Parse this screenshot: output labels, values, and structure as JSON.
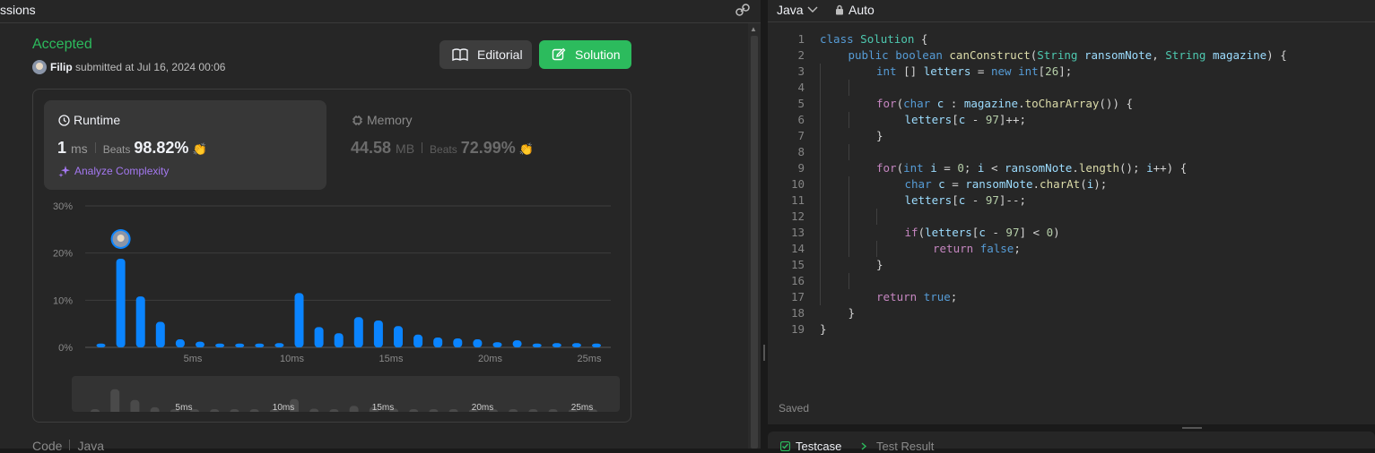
{
  "left_panel": {
    "header_title": "ssions",
    "status": "Accepted",
    "submitter": "Filip",
    "submitted_text": "submitted at Jul 16, 2024 00:06",
    "editorial_label": "Editorial",
    "solution_label": "Solution",
    "runtime": {
      "label": "Runtime",
      "value": "1",
      "unit": "ms",
      "beats_label": "Beats",
      "beats_pct": "98.82%",
      "analyze_label": "Analyze Complexity"
    },
    "memory": {
      "label": "Memory",
      "value": "44.58",
      "unit": "MB",
      "beats_label": "Beats",
      "beats_pct": "72.99%"
    },
    "code_tab": "Code",
    "code_lang": "Java"
  },
  "chart_data": {
    "type": "bar",
    "y_tick_labels": [
      "0%",
      "10%",
      "20%",
      "30%"
    ],
    "x_tick_labels": [
      "5ms",
      "10ms",
      "15ms",
      "20ms",
      "25ms"
    ],
    "ylim": [
      0,
      30
    ],
    "x": [
      0,
      1,
      2,
      3,
      4,
      5,
      6,
      7,
      8,
      9,
      10,
      11,
      12,
      13,
      14,
      15,
      16,
      17,
      18,
      19,
      20,
      21,
      22,
      23,
      24,
      25,
      26
    ],
    "values": [
      0.8,
      18.8,
      10.8,
      5.4,
      1.7,
      1.2,
      0.8,
      0.8,
      0.8,
      0.9,
      11.5,
      4.3,
      3.0,
      6.4,
      5.7,
      4.5,
      2.7,
      2.1,
      1.9,
      1.7,
      1.1,
      1.5,
      0.8,
      0.9,
      0.9,
      0.8,
      0
    ],
    "highlight_index": 1,
    "bar_color": "#0a84ff",
    "mini_color": "#4a4a4a",
    "grid": true
  },
  "editor": {
    "language": "Java",
    "mode": "Auto",
    "saved": "Saved",
    "lines": [
      {
        "n": "1",
        "indent": 0
      },
      {
        "n": "2",
        "indent": 1
      },
      {
        "n": "3",
        "indent": 2
      },
      {
        "n": "4",
        "indent": 2
      },
      {
        "n": "5",
        "indent": 2
      },
      {
        "n": "6",
        "indent": 3
      },
      {
        "n": "7",
        "indent": 2
      },
      {
        "n": "8",
        "indent": 2
      },
      {
        "n": "9",
        "indent": 2
      },
      {
        "n": "10",
        "indent": 3
      },
      {
        "n": "11",
        "indent": 3
      },
      {
        "n": "12",
        "indent": 3
      },
      {
        "n": "13",
        "indent": 3
      },
      {
        "n": "14",
        "indent": 4
      },
      {
        "n": "15",
        "indent": 2
      },
      {
        "n": "16",
        "indent": 2
      },
      {
        "n": "17",
        "indent": 2
      },
      {
        "n": "18",
        "indent": 1
      },
      {
        "n": "19",
        "indent": 0
      }
    ],
    "tokens": [
      [
        [
          "kw",
          "class"
        ],
        [
          "",
          " "
        ],
        [
          "ty",
          "Solution"
        ],
        [
          "",
          " {"
        ]
      ],
      [
        [
          "kw",
          "public"
        ],
        [
          "",
          " "
        ],
        [
          "kw",
          "boolean"
        ],
        [
          "",
          " "
        ],
        [
          "fn",
          "canConstruct"
        ],
        [
          "",
          "("
        ],
        [
          "ty",
          "String"
        ],
        [
          "",
          " "
        ],
        [
          "vr",
          "ransomNote"
        ],
        [
          "",
          ", "
        ],
        [
          "ty",
          "String"
        ],
        [
          "",
          " "
        ],
        [
          "vr",
          "magazine"
        ],
        [
          "",
          ") {"
        ]
      ],
      [
        [
          "kw",
          "int"
        ],
        [
          "",
          " [] "
        ],
        [
          "vr",
          "letters"
        ],
        [
          "",
          " = "
        ],
        [
          "kw",
          "new"
        ],
        [
          "",
          " "
        ],
        [
          "kw",
          "int"
        ],
        [
          "",
          "["
        ],
        [
          "nm",
          "26"
        ],
        [
          "",
          "];"
        ]
      ],
      [],
      [
        [
          "ctl",
          "for"
        ],
        [
          "",
          "("
        ],
        [
          "kw",
          "char"
        ],
        [
          "",
          " "
        ],
        [
          "vr",
          "c"
        ],
        [
          "",
          " : "
        ],
        [
          "vr",
          "magazine"
        ],
        [
          "",
          "."
        ],
        [
          "fn",
          "toCharArray"
        ],
        [
          "",
          "()) {"
        ]
      ],
      [
        [
          "vr",
          "letters"
        ],
        [
          "",
          "["
        ],
        [
          "vr",
          "c"
        ],
        [
          "",
          " - "
        ],
        [
          "nm",
          "97"
        ],
        [
          "",
          "]++;"
        ]
      ],
      [
        [
          "",
          "}"
        ]
      ],
      [],
      [
        [
          "ctl",
          "for"
        ],
        [
          "",
          "("
        ],
        [
          "kw",
          "int"
        ],
        [
          "",
          " "
        ],
        [
          "vr",
          "i"
        ],
        [
          "",
          " = "
        ],
        [
          "nm",
          "0"
        ],
        [
          "",
          "; "
        ],
        [
          "vr",
          "i"
        ],
        [
          "",
          " < "
        ],
        [
          "vr",
          "ransomNote"
        ],
        [
          "",
          "."
        ],
        [
          "fn",
          "length"
        ],
        [
          "",
          "(); "
        ],
        [
          "vr",
          "i"
        ],
        [
          "",
          "++) {"
        ]
      ],
      [
        [
          "kw",
          "char"
        ],
        [
          "",
          " "
        ],
        [
          "vr",
          "c"
        ],
        [
          "",
          " = "
        ],
        [
          "vr",
          "ransomNote"
        ],
        [
          "",
          "."
        ],
        [
          "fn",
          "charAt"
        ],
        [
          "",
          "("
        ],
        [
          "vr",
          "i"
        ],
        [
          "",
          ");"
        ]
      ],
      [
        [
          "vr",
          "letters"
        ],
        [
          "",
          "["
        ],
        [
          "vr",
          "c"
        ],
        [
          "",
          " - "
        ],
        [
          "nm",
          "97"
        ],
        [
          "",
          "]--;"
        ]
      ],
      [],
      [
        [
          "ctl",
          "if"
        ],
        [
          "",
          "("
        ],
        [
          "vr",
          "letters"
        ],
        [
          "",
          "["
        ],
        [
          "vr",
          "c"
        ],
        [
          "",
          " - "
        ],
        [
          "nm",
          "97"
        ],
        [
          "",
          "] < "
        ],
        [
          "nm",
          "0"
        ],
        [
          "",
          ")"
        ]
      ],
      [
        [
          "ctl",
          "return"
        ],
        [
          "",
          " "
        ],
        [
          "kw",
          "false"
        ],
        [
          "",
          ";"
        ]
      ],
      [
        [
          "",
          "}"
        ]
      ],
      [],
      [
        [
          "ctl",
          "return"
        ],
        [
          "",
          " "
        ],
        [
          "kw",
          "true"
        ],
        [
          "",
          ";"
        ]
      ],
      [
        [
          "",
          "}"
        ]
      ],
      [
        [
          "",
          "}"
        ]
      ]
    ]
  },
  "bottom_panel": {
    "testcase_label": "Testcase",
    "test_result_label": "Test Result"
  },
  "colors": {
    "accepted": "#2cbb5d",
    "solution_button": "#2cbb5d",
    "analyze": "#a478f0",
    "bar": "#0a84ff"
  }
}
